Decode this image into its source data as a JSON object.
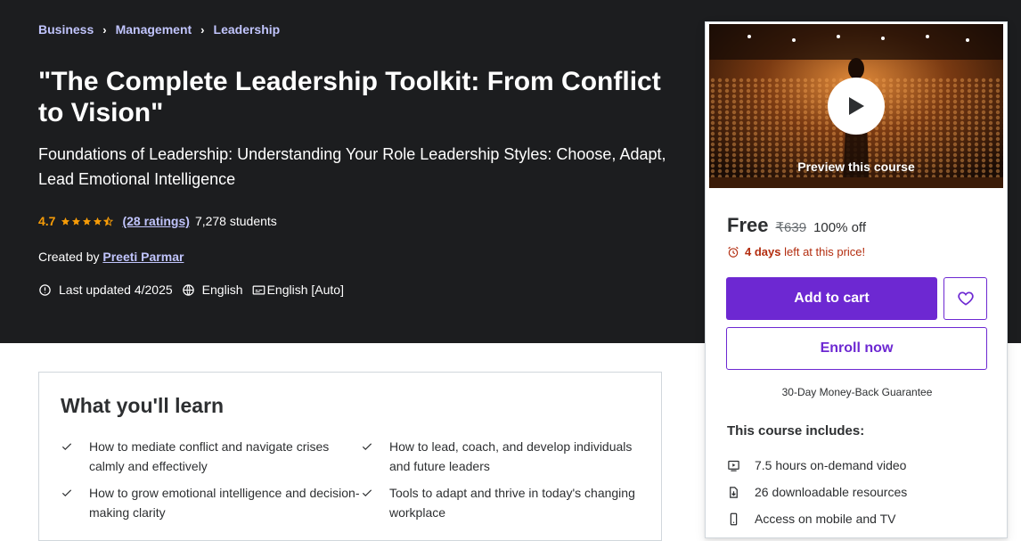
{
  "breadcrumb": [
    "Business",
    "Management",
    "Leadership"
  ],
  "course": {
    "title": "\"The Complete Leadership Toolkit: From Conflict to Vision\"",
    "subtitle": "Foundations of Leadership: Understanding Your Role Leadership Styles: Choose, Adapt, Lead Emotional Intelligence",
    "rating": "4.7",
    "rating_value": 4.7,
    "ratings_link": "(28 ratings)",
    "students": "7,278 students",
    "created_by_label": "Created by",
    "instructor": "Preeti Parmar",
    "last_updated": "Last updated 4/2025",
    "language": "English",
    "captions": "English [Auto]"
  },
  "sidebar": {
    "preview_label": "Preview this course",
    "price": "Free",
    "original_price": "₹639",
    "discount": "100% off",
    "timer_strong": "4 days",
    "timer_rest": "left at this price!",
    "add_to_cart": "Add to cart",
    "enroll": "Enroll now",
    "guarantee": "30-Day Money-Back Guarantee",
    "includes_title": "This course includes:",
    "includes": [
      {
        "icon": "video-icon",
        "text": "7.5 hours on-demand video"
      },
      {
        "icon": "download-icon",
        "text": "26 downloadable resources"
      },
      {
        "icon": "mobile-icon",
        "text": "Access on mobile and TV"
      }
    ]
  },
  "learn": {
    "title": "What you'll learn",
    "items": [
      "How to mediate conflict and navigate crises calmly and effectively",
      "How to lead, coach, and develop individuals and future leaders",
      "How to grow emotional intelligence and decision-making clarity",
      "Tools to adapt and thrive in today's changing workplace"
    ]
  },
  "colors": {
    "hero_bg": "#1c1d1f",
    "accent": "#6d28d2",
    "link": "#c0c4fc",
    "star": "#f69c08",
    "timer": "#b32d0f"
  }
}
